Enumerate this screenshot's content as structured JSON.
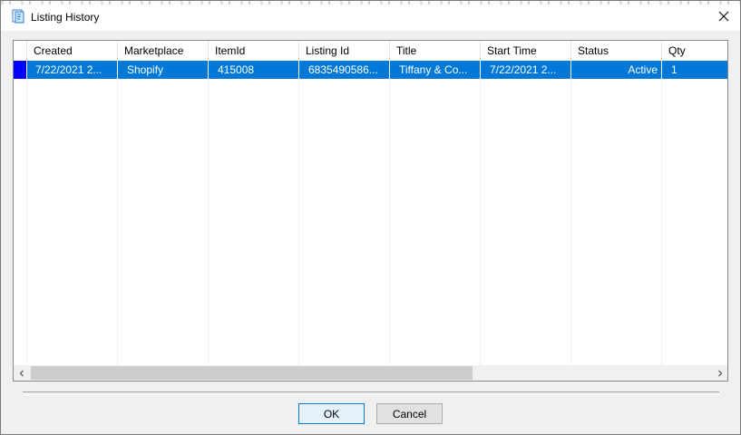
{
  "window": {
    "title": "Listing History",
    "close_glyph": "✕"
  },
  "grid": {
    "columns": [
      "Created",
      "Marketplace",
      "ItemId",
      "Listing Id",
      "Title",
      "Start Time",
      "Status",
      "Qty"
    ],
    "rows": [
      {
        "selected": true,
        "cells": [
          "7/22/2021 2...",
          "Shopify",
          "415008",
          "6835490586...",
          "Tiffany & Co...",
          "7/22/2021 2...",
          "Active",
          "1"
        ]
      }
    ],
    "selection_color": "#0078d7",
    "row_indicator_color": "#0000ff"
  },
  "scrollbar": {
    "left_arrow": "‹",
    "right_arrow": "›"
  },
  "buttons": {
    "ok_label": "OK",
    "cancel_label": "Cancel"
  }
}
